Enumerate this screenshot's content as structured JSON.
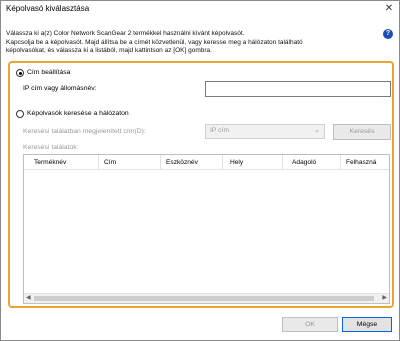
{
  "window": {
    "title": "Képolvasó kiválasztása",
    "close_glyph": "✕"
  },
  "description": {
    "line1": "Válassza ki a(z) Color Network ScanGear 2 termékkel használni kívánt képolvasót.",
    "line2": "Kapcsolja be a képolvasót. Majd állítsa be a címét közvetlenül, vagy keresse meg a hálózaton található",
    "line3": "képolvasókat, és válassza ki a listából, majd kattintson az [OK] gombra."
  },
  "help": {
    "glyph": "?"
  },
  "address_setting": {
    "radio_label": "Cím beállítása",
    "field_label": "IP cím vagy állomásnév:",
    "field_value": ""
  },
  "search": {
    "radio_label": "Képolvasók keresése a hálózaton",
    "addr_type_label": "Keresési találatban megjelenített cím(D):",
    "addr_type_value": "IP cím",
    "search_button": "Keresés",
    "results_label": "Keresési találatok:"
  },
  "table": {
    "columns": [
      "Terméknév",
      "Cím",
      "Eszköznév",
      "Hely",
      "Adagoló",
      "Felhaszná"
    ]
  },
  "footer": {
    "ok_button": "OK",
    "cancel_button": "Mégse"
  },
  "colors": {
    "group_border": "#e9a531",
    "focus_border": "#0a64d6",
    "help_icon": "#1c4fb5"
  }
}
